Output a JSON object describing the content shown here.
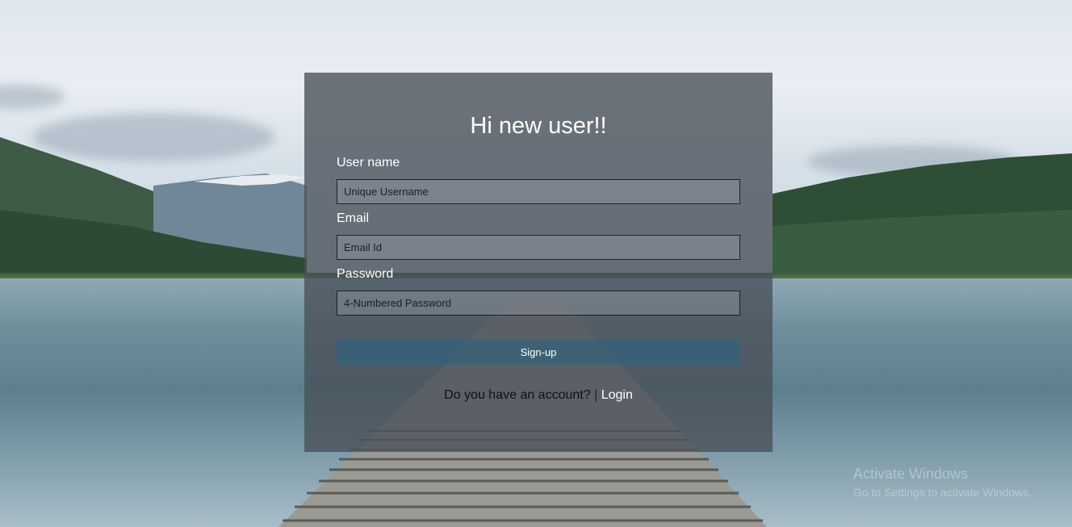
{
  "form": {
    "title": "Hi new user!!",
    "username_label": "User name",
    "username_placeholder": "Unique Username",
    "email_label": "Email",
    "email_placeholder": "Email Id",
    "password_label": "Password",
    "password_placeholder": "4-Numbered Password",
    "signup_label": "Sign-up",
    "account_prompt": "Do you have an account?",
    "separator": "|",
    "login_label": "Login"
  },
  "watermark": {
    "title": "Activate Windows",
    "subtitle": "Go to Settings to activate Windows."
  },
  "colors": {
    "card_bg": "#485058",
    "button_bg": "#28648a",
    "text": "#ffffff"
  }
}
